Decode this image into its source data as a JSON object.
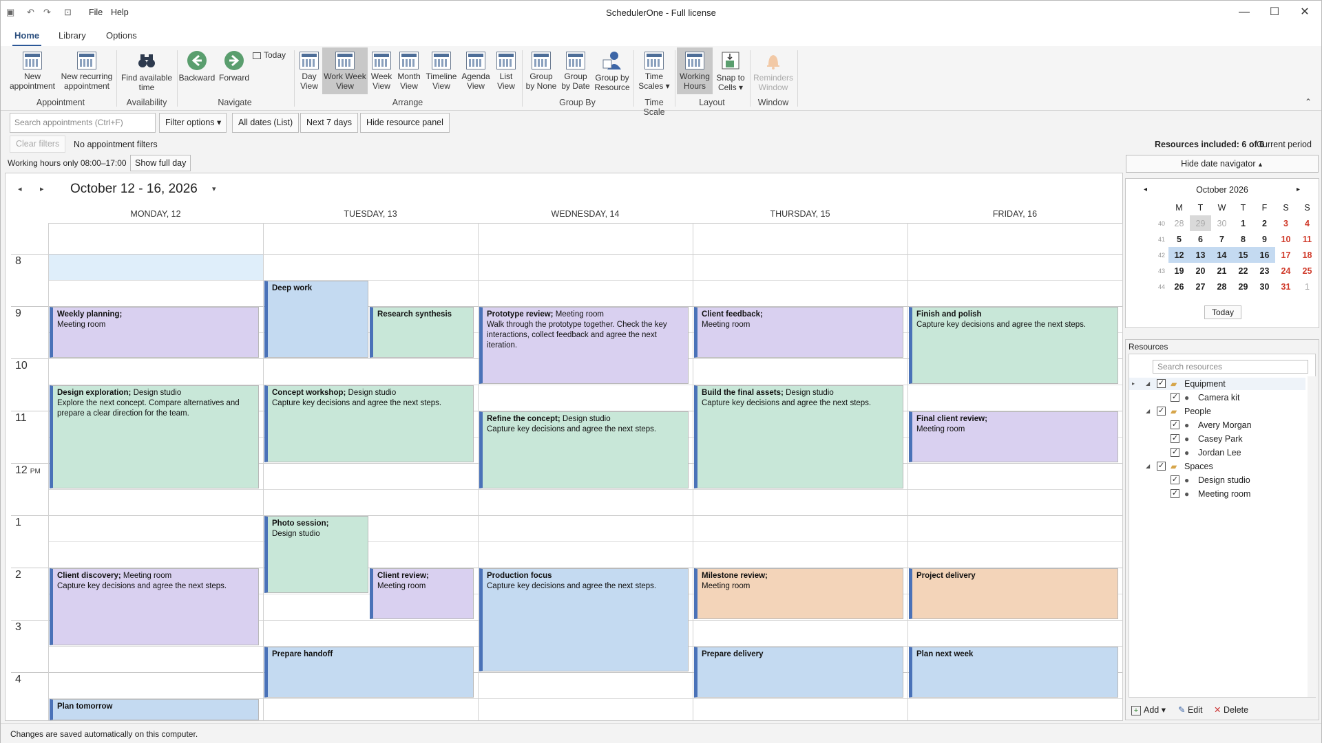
{
  "window": {
    "title": "SchedulerOne - Full license",
    "menu": [
      "File",
      "Help"
    ]
  },
  "ribbon": {
    "tabs": [
      "Home",
      "Library",
      "Options"
    ],
    "groups": {
      "appointment": "Appointment",
      "availability": "Availability",
      "navigate": "Navigate",
      "arrange": "Arrange",
      "group_by": "Group By",
      "time_scale": "Time Scale",
      "layout": "Layout",
      "window": "Window"
    },
    "buttons": {
      "new_appointment": [
        "New",
        "appointment"
      ],
      "new_recurring": [
        "New recurring",
        "appointment"
      ],
      "find_time": [
        "Find available",
        "time"
      ],
      "backward": "Backward",
      "forward": "Forward",
      "today": "Today",
      "day_view": [
        "Day",
        "View"
      ],
      "work_week_view": [
        "Work Week",
        "View"
      ],
      "week_view": [
        "Week",
        "View"
      ],
      "month_view": [
        "Month",
        "View"
      ],
      "timeline_view": [
        "Timeline",
        "View"
      ],
      "agenda_view": [
        "Agenda",
        "View"
      ],
      "list_view": [
        "List",
        "View"
      ],
      "group_none": [
        "Group",
        "by None"
      ],
      "group_date": [
        "Group",
        "by Date"
      ],
      "group_resource": [
        "Group by",
        "Resource"
      ],
      "time_scales": [
        "Time",
        "Scales"
      ],
      "working_hours": [
        "Working",
        "Hours"
      ],
      "snap_cells": [
        "Snap to",
        "Cells"
      ],
      "reminders": [
        "Reminders",
        "Window"
      ]
    }
  },
  "filters": {
    "search_placeholder": "Search appointments (Ctrl+F)",
    "filter_options": "Filter options",
    "all_dates": "All dates (List)",
    "next7": "Next 7 days",
    "hide_resource": "Hide resource panel",
    "clear_filters": "Clear filters",
    "no_filters": "No appointment filters",
    "resources_included": "Resources included: 6 of 6",
    "current_period": "Current period",
    "working_hours": "Working hours only 08:00–17:00",
    "show_full_day": "Show full day",
    "hide_date_nav": "Hide date navigator"
  },
  "calendar": {
    "range": "October 12 - 16, 2026",
    "days": [
      "MONDAY, 12",
      "TUESDAY, 13",
      "WEDNESDAY, 14",
      "THURSDAY, 15",
      "FRIDAY, 16"
    ],
    "hours": [
      "8",
      "9",
      "10",
      "11",
      "12",
      "1",
      "2",
      "3",
      "4"
    ],
    "pm": "PM",
    "appointments": [
      {
        "day": 0,
        "col": 0,
        "cols": 1,
        "start": 9,
        "end": 10,
        "title": "Weekly planning;",
        "loc": "Meeting room",
        "desc": "",
        "color": "purple",
        "locbreak": true
      },
      {
        "day": 0,
        "col": 0,
        "cols": 1,
        "start": 10.5,
        "end": 12.5,
        "title": "Design exploration;",
        "loc": "Design studio",
        "desc": "Explore the next concept. Compare alternatives and prepare a clear direction for the team.",
        "color": "green"
      },
      {
        "day": 0,
        "col": 0,
        "cols": 1,
        "start": 14,
        "end": 15.5,
        "title": "Client discovery;",
        "loc": "Meeting room",
        "desc": "Capture key decisions and agree the next steps.",
        "color": "purple"
      },
      {
        "day": 0,
        "col": 0,
        "cols": 1,
        "start": 16.5,
        "end": 18,
        "title": "Plan tomorrow",
        "loc": "",
        "desc": "",
        "color": "blue"
      },
      {
        "day": 1,
        "col": 0,
        "cols": 2,
        "start": 8.5,
        "end": 10,
        "title": "Deep work",
        "loc": "",
        "desc": "",
        "color": "blue"
      },
      {
        "day": 1,
        "col": 1,
        "cols": 2,
        "start": 9,
        "end": 10,
        "title": "Research synthesis",
        "loc": "",
        "desc": "",
        "color": "green"
      },
      {
        "day": 1,
        "col": 0,
        "cols": 1,
        "start": 10.5,
        "end": 12,
        "title": "Concept workshop;",
        "loc": "Design studio",
        "desc": "Capture key decisions and agree the next steps.",
        "color": "green"
      },
      {
        "day": 1,
        "col": 0,
        "cols": 2,
        "start": 13,
        "end": 14.5,
        "title": "Photo session;",
        "loc": "Design studio",
        "desc": "",
        "color": "green",
        "locbreak": true
      },
      {
        "day": 1,
        "col": 1,
        "cols": 2,
        "start": 14,
        "end": 15,
        "title": "Client review;",
        "loc": "Meeting room",
        "desc": "",
        "color": "purple",
        "locbreak": true
      },
      {
        "day": 1,
        "col": 0,
        "cols": 1,
        "start": 15.5,
        "end": 16.5,
        "title": "Prepare handoff",
        "loc": "",
        "desc": "",
        "color": "blue"
      },
      {
        "day": 2,
        "col": 0,
        "cols": 1,
        "start": 9,
        "end": 10.5,
        "title": "Prototype review;",
        "loc": "Meeting room",
        "desc": "Walk through the prototype together. Check the key interactions, collect feedback and agree the next iteration.",
        "color": "purple"
      },
      {
        "day": 2,
        "col": 0,
        "cols": 1,
        "start": 11,
        "end": 12.5,
        "title": "Refine the concept;",
        "loc": "Design studio",
        "desc": "Capture key decisions and agree the next steps.",
        "color": "green"
      },
      {
        "day": 2,
        "col": 0,
        "cols": 1,
        "start": 14,
        "end": 16,
        "title": "Production focus",
        "loc": "",
        "desc": "Capture key decisions and agree the next steps.",
        "color": "blue"
      },
      {
        "day": 3,
        "col": 0,
        "cols": 1,
        "start": 9,
        "end": 10,
        "title": "Client feedback;",
        "loc": "Meeting room",
        "desc": "",
        "color": "purple",
        "locbreak": true
      },
      {
        "day": 3,
        "col": 0,
        "cols": 1,
        "start": 10.5,
        "end": 12.5,
        "title": "Build the final assets;",
        "loc": "Design studio",
        "desc": "Capture key decisions and agree the next steps.",
        "color": "green"
      },
      {
        "day": 3,
        "col": 0,
        "cols": 1,
        "start": 14,
        "end": 15,
        "title": "Milestone review;",
        "loc": "Meeting room",
        "desc": "",
        "color": "orange",
        "locbreak": true
      },
      {
        "day": 3,
        "col": 0,
        "cols": 1,
        "start": 15.5,
        "end": 16.5,
        "title": "Prepare delivery",
        "loc": "",
        "desc": "",
        "color": "blue"
      },
      {
        "day": 4,
        "col": 0,
        "cols": 1,
        "start": 9,
        "end": 10.5,
        "title": "Finish and polish",
        "loc": "",
        "desc": "Capture key decisions and agree the next steps.",
        "color": "green"
      },
      {
        "day": 4,
        "col": 0,
        "cols": 1,
        "start": 11,
        "end": 12,
        "title": "Final client review;",
        "loc": "Meeting room",
        "desc": "",
        "color": "purple",
        "locbreak": true
      },
      {
        "day": 4,
        "col": 0,
        "cols": 1,
        "start": 14,
        "end": 15,
        "title": "Project delivery",
        "loc": "",
        "desc": "",
        "color": "orange"
      },
      {
        "day": 4,
        "col": 0,
        "cols": 1,
        "start": 15.5,
        "end": 16.5,
        "title": "Plan next week",
        "loc": "",
        "desc": "",
        "color": "blue"
      }
    ]
  },
  "navigator": {
    "month": "October 2026",
    "dow": [
      "M",
      "T",
      "W",
      "T",
      "F",
      "S",
      "S"
    ],
    "weeks": [
      {
        "wk": "40",
        "days": [
          "28",
          "29",
          "30",
          "1",
          "2",
          "3",
          "4"
        ]
      },
      {
        "wk": "41",
        "days": [
          "5",
          "6",
          "7",
          "8",
          "9",
          "10",
          "11"
        ]
      },
      {
        "wk": "42",
        "days": [
          "12",
          "13",
          "14",
          "15",
          "16",
          "17",
          "18"
        ]
      },
      {
        "wk": "43",
        "days": [
          "19",
          "20",
          "21",
          "22",
          "23",
          "24",
          "25"
        ]
      },
      {
        "wk": "44",
        "days": [
          "26",
          "27",
          "28",
          "29",
          "30",
          "31",
          "1"
        ]
      }
    ],
    "today_btn": "Today"
  },
  "resources": {
    "header": "Resources",
    "search_placeholder": "Search resources",
    "tree": [
      {
        "label": "Equipment",
        "level": 0,
        "type": "folder"
      },
      {
        "label": "Camera kit",
        "level": 1,
        "type": "person"
      },
      {
        "label": "People",
        "level": 0,
        "type": "folder"
      },
      {
        "label": "Avery Morgan",
        "level": 1,
        "type": "person"
      },
      {
        "label": "Casey Park",
        "level": 1,
        "type": "person"
      },
      {
        "label": "Jordan Lee",
        "level": 1,
        "type": "person"
      },
      {
        "label": "Spaces",
        "level": 0,
        "type": "folder"
      },
      {
        "label": "Design studio",
        "level": 1,
        "type": "person"
      },
      {
        "label": "Meeting room",
        "level": 1,
        "type": "person"
      }
    ],
    "add": "Add",
    "edit": "Edit",
    "delete": "Delete"
  },
  "status": "Changes are saved automatically on this computer.",
  "colors": {
    "purple": "#d9d0f0",
    "green": "#c8e7d8",
    "blue": "#c4daf1",
    "orange": "#f3d4b9",
    "accent": "#4a72b8"
  }
}
